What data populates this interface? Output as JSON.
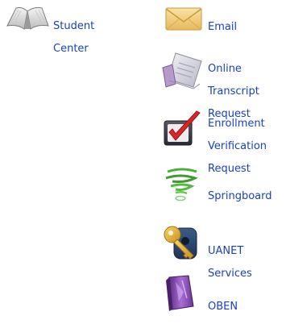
{
  "links": {
    "student_center": {
      "line1": "Student",
      "line2": "Center",
      "icon": "open-book-icon"
    },
    "email": {
      "line1": "Email",
      "icon": "envelope-icon"
    },
    "transcript": {
      "line1": "Online",
      "line2": "Transcript",
      "line3": "Request",
      "icon": "transcript-document-icon"
    },
    "enrollment": {
      "line1": "Enrollment",
      "line2": "Verification",
      "line3": "Request",
      "icon": "checkmark-box-icon"
    },
    "springboard": {
      "line1": "Springboard",
      "icon": "green-swirl-icon"
    },
    "uanet": {
      "line1": "UANET",
      "line2": "Services",
      "icon": "key-lock-icon"
    },
    "oben": {
      "line1": "OBEN",
      "icon": "purple-book-icon"
    }
  },
  "colors": {
    "link": "#1a3fc2"
  }
}
